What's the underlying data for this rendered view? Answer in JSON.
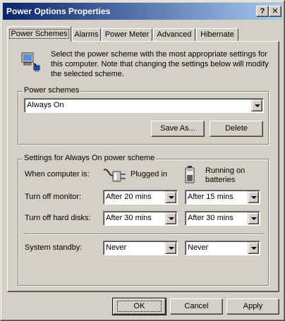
{
  "window": {
    "title": "Power Options Properties",
    "help_glyph": "?",
    "close_glyph": "✕"
  },
  "tabs": [
    {
      "label": "Power Schemes",
      "active": true
    },
    {
      "label": "Alarms"
    },
    {
      "label": "Power Meter"
    },
    {
      "label": "Advanced"
    },
    {
      "label": "Hibernate"
    }
  ],
  "intro": {
    "text": "Select the power scheme with the most appropriate settings for this computer. Note that changing the settings below will modify the selected scheme."
  },
  "power_schemes": {
    "group_title": "Power schemes",
    "selected": "Always On",
    "save_as_label": "Save As...",
    "delete_label": "Delete"
  },
  "settings": {
    "group_title": "Settings for Always On power scheme",
    "when_label": "When computer is:",
    "plugged_in_label": "Plugged in",
    "batteries_label": "Running on batteries",
    "monitor_label": "Turn off monitor:",
    "monitor_plugged": "After 20 mins",
    "monitor_battery": "After 15 mins",
    "disks_label": "Turn off hard disks:",
    "disks_plugged": "After 30 mins",
    "disks_battery": "After 30 mins",
    "standby_label": "System standby:",
    "standby_plugged": "Never",
    "standby_battery": "Never"
  },
  "buttons": {
    "ok": "OK",
    "cancel": "Cancel",
    "apply": "Apply"
  },
  "icons": {
    "scheme_icon": "power-plug-computer-icon",
    "plugged_icon": "power-plug-icon",
    "battery_icon": "battery-icon"
  }
}
